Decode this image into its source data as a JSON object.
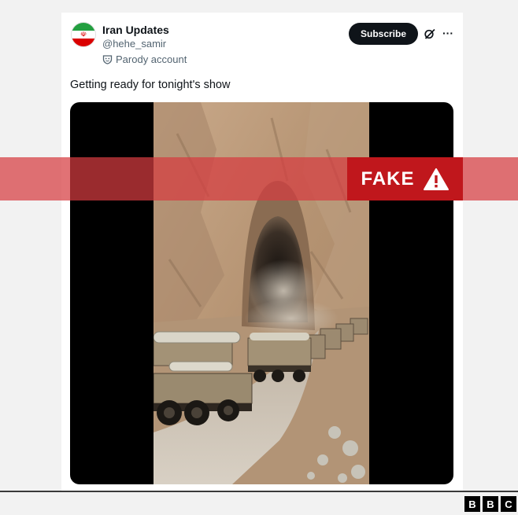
{
  "tweet": {
    "display_name": "Iran Updates",
    "handle": "@hehe_samir",
    "account_label": "Parody account",
    "subscribe_label": "Subscribe",
    "more_label": "···",
    "text": "Getting ready for tonight's show",
    "avatar_flag_colors": [
      "#239f40",
      "#ffffff",
      "#da0000"
    ]
  },
  "overlay": {
    "label": "FAKE",
    "band_color": "#d63c40",
    "label_color": "#c0171c"
  },
  "branding": {
    "letters": [
      "B",
      "B",
      "C"
    ]
  }
}
